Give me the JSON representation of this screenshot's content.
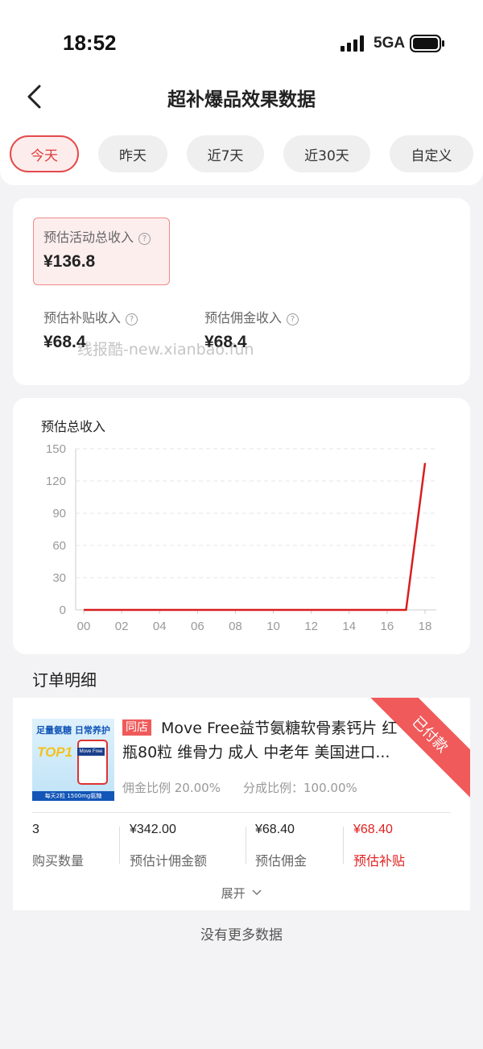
{
  "status_bar": {
    "time": "18:52",
    "network": "5GA"
  },
  "header": {
    "title": "超补爆品效果数据"
  },
  "tabs": [
    {
      "label": "今天",
      "active": true
    },
    {
      "label": "昨天",
      "active": false
    },
    {
      "label": "近7天",
      "active": false
    },
    {
      "label": "近30天",
      "active": false
    },
    {
      "label": "自定义",
      "active": false
    }
  ],
  "summary": {
    "total_label": "预估活动总收入",
    "total_value": "¥136.8",
    "subsidy_label": "预估补贴收入",
    "subsidy_value": "¥68.4",
    "commission_label": "预估佣金收入",
    "commission_value": "¥68.4",
    "watermark": "线报酷-new.xianbao.fun"
  },
  "chart_data": {
    "type": "line",
    "title": "预估总收入",
    "x": [
      "00",
      "01",
      "02",
      "03",
      "04",
      "05",
      "06",
      "07",
      "08",
      "09",
      "10",
      "11",
      "12",
      "13",
      "14",
      "15",
      "16",
      "17",
      "18"
    ],
    "x_tick_labels": [
      "00",
      "02",
      "04",
      "06",
      "08",
      "10",
      "12",
      "14",
      "16",
      "18"
    ],
    "y_tick_labels": [
      "150",
      "120",
      "90",
      "60",
      "30",
      "0"
    ],
    "series": [
      {
        "values": [
          0,
          0,
          0,
          0,
          0,
          0,
          0,
          0,
          0,
          0,
          0,
          0,
          0,
          0,
          0,
          0,
          0,
          0,
          136.8
        ]
      }
    ],
    "ylim": [
      0,
      150
    ],
    "grid": true,
    "color": "#d81e1e"
  },
  "orders": {
    "section_title": "订单明细",
    "items": [
      {
        "tag": "同店",
        "title": "Move Free益节氨糖软骨素钙片 红瓶80粒 维骨力 成人 中老年 美国进口...",
        "commission_rate": "佣金比例 20.00%",
        "share_rate": "分成比例：100.00%",
        "ribbon": "已付款",
        "stats": [
          {
            "value": "3",
            "label": "购买数量"
          },
          {
            "value": "¥342.00",
            "label": "预估计佣金额"
          },
          {
            "value": "¥68.40",
            "label": "预估佣金"
          },
          {
            "value": "¥68.40",
            "label": "预估补贴"
          }
        ],
        "expand_label": "展开",
        "thumb": {
          "headline": "足量氨糖 日常养护",
          "badge": "TOP1",
          "brand": "Move Free",
          "footer": "每天2粒 1500mg氨糖"
        }
      }
    ],
    "no_more": "没有更多数据"
  },
  "colors": {
    "accent": "#e03a3a",
    "ribbon": "#f05a5a"
  }
}
